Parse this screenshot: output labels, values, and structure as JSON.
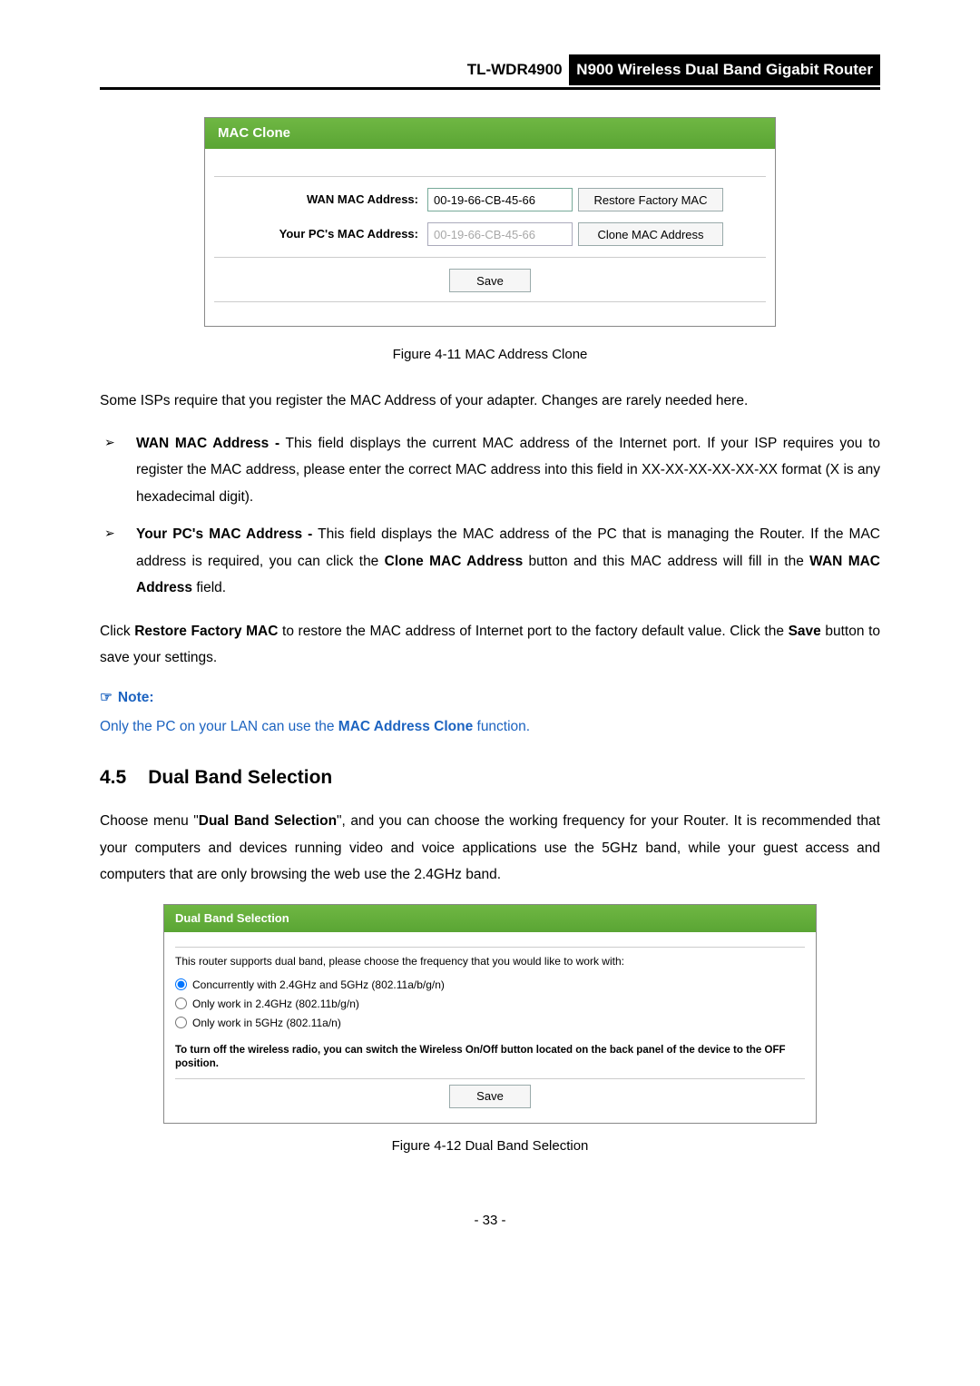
{
  "header": {
    "model": "TL-WDR4900",
    "subtitle": "N900 Wireless Dual Band Gigabit Router"
  },
  "macClone": {
    "title": "MAC Clone",
    "wanLabel": "WAN MAC Address:",
    "wanValue": "00-19-66-CB-45-66",
    "restoreBtn": "Restore Factory MAC",
    "pcLabel": "Your PC's MAC Address:",
    "pcValue": "00-19-66-CB-45-66",
    "cloneBtn": "Clone MAC Address",
    "saveBtn": "Save",
    "figCaption": "Figure 4-11 MAC Address Clone"
  },
  "body": {
    "intro": "Some ISPs require that you register the MAC Address of your adapter. Changes are rarely needed here.",
    "bullet1_strong": "WAN MAC Address -",
    "bullet1_rest": " This field displays the current MAC address of the Internet port. If your ISP requires you to register the MAC address, please enter the correct MAC address into this field in XX-XX-XX-XX-XX-XX format (X is any hexadecimal digit).",
    "bullet2_strong": "Your PC's MAC Address -",
    "bullet2_mid": " This field displays the MAC address of the PC that is managing the Router. If the MAC address is required, you can click the ",
    "bullet2_bold1": "Clone MAC Address",
    "bullet2_mid2": " button and this MAC address will fill in the ",
    "bullet2_bold2": "WAN MAC Address",
    "bullet2_end": " field.",
    "restorePara_a": "Click ",
    "restorePara_b": "Restore Factory MAC",
    "restorePara_c": " to restore the MAC address of Internet port to the factory default value. Click the ",
    "restorePara_d": "Save",
    "restorePara_e": " button to save your settings.",
    "noteIcon": "☞",
    "noteHead": "Note:",
    "noteBody_a": "Only the PC on your LAN can use the ",
    "noteBody_b": "MAC Address Clone",
    "noteBody_c": " function."
  },
  "section45": {
    "num": "4.5",
    "title": "Dual Band Selection",
    "intro_a": "Choose menu \"",
    "intro_b": "Dual Band Selection",
    "intro_c": "\", and you can choose the working frequency for your Router. It is recommended that your computers and devices running video and voice applications use the 5GHz band, while your guest access and computers that are only browsing the web use the 2.4GHz band."
  },
  "dualBand": {
    "title": "Dual Band Selection",
    "intro": "This router supports dual band, please choose the frequency that you would like to work with:",
    "opt1": "Concurrently with 2.4GHz and 5GHz (802.11a/b/g/n)",
    "opt2": "Only work in 2.4GHz (802.11b/g/n)",
    "opt3": "Only work in 5GHz (802.11a/n)",
    "offNote": "To turn off the wireless radio, you can switch the Wireless On/Off button located on the back panel of the device to the OFF position.",
    "saveBtn": "Save",
    "figCaption": "Figure 4-12 Dual Band Selection"
  },
  "pageNum": "- 33 -"
}
